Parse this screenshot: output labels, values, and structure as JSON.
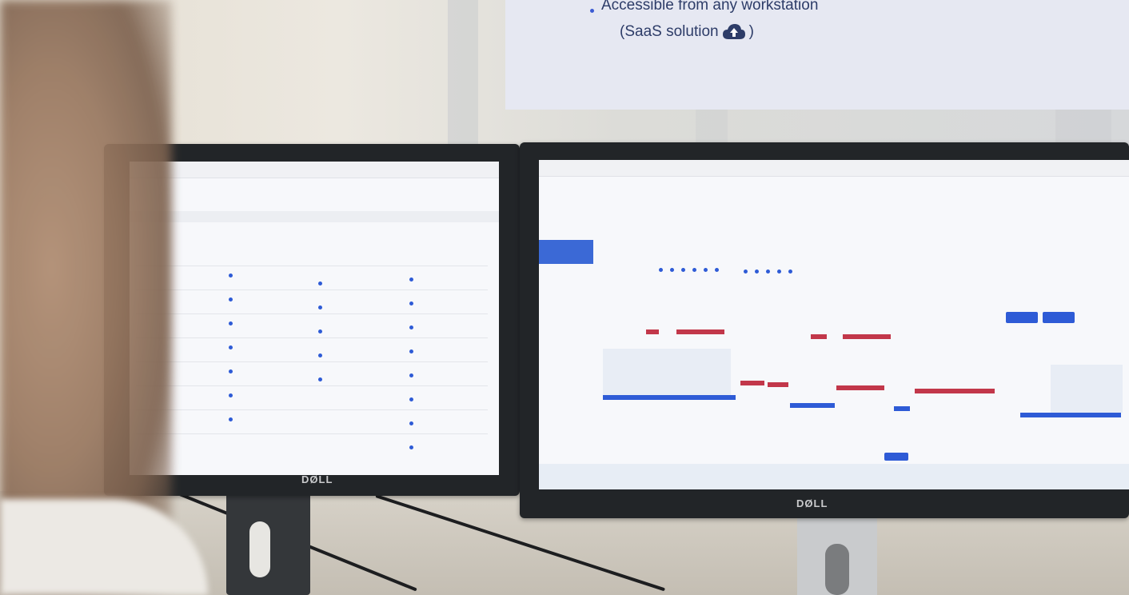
{
  "panel": {
    "line1": "Accessible from any workstation",
    "line2_prefix": "(SaaS solution",
    "line2_suffix": ")",
    "icon": "cloud-upload-icon",
    "accent_color": "#2d3c68",
    "bullet_color": "#3b5bd3"
  },
  "monitors": {
    "left_brand": "DØLL",
    "right_brand": "DØLL"
  }
}
